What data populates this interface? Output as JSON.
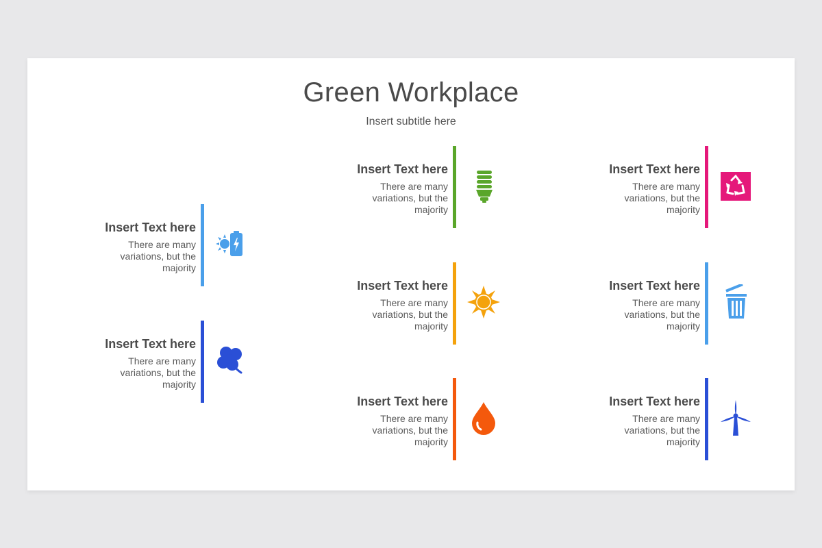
{
  "slide": {
    "title": "Green Workplace",
    "subtitle": "Insert subtitle here"
  },
  "items": [
    {
      "heading": "Insert Text here",
      "desc": "There are many variations, but the majority",
      "color": "#4a9fea",
      "icon": "solar-battery-icon"
    },
    {
      "heading": "Insert Text here",
      "desc": "There are many variations, but the majority",
      "color": "#2a4fd6",
      "icon": "clover-icon"
    },
    {
      "heading": "Insert Text here",
      "desc": "There are many variations, but the majority",
      "color": "#5aa62a",
      "icon": "light-bulb-icon"
    },
    {
      "heading": "Insert Text here",
      "desc": "There are many variations, but the majority",
      "color": "#f4a20c",
      "icon": "sun-icon"
    },
    {
      "heading": "Insert Text here",
      "desc": "There are many variations, but the majority",
      "color": "#f4590c",
      "icon": "water-drop-icon"
    },
    {
      "heading": "Insert Text here",
      "desc": "There are many variations, but the majority",
      "color": "#e5187a",
      "icon": "recycle-icon"
    },
    {
      "heading": "Insert Text here",
      "desc": "There are many variations, but the majority",
      "color": "#4a9fea",
      "icon": "trash-bin-icon"
    },
    {
      "heading": "Insert Text here",
      "desc": "There are many variations, but the majority",
      "color": "#2a4fd6",
      "icon": "wind-turbine-icon"
    }
  ]
}
